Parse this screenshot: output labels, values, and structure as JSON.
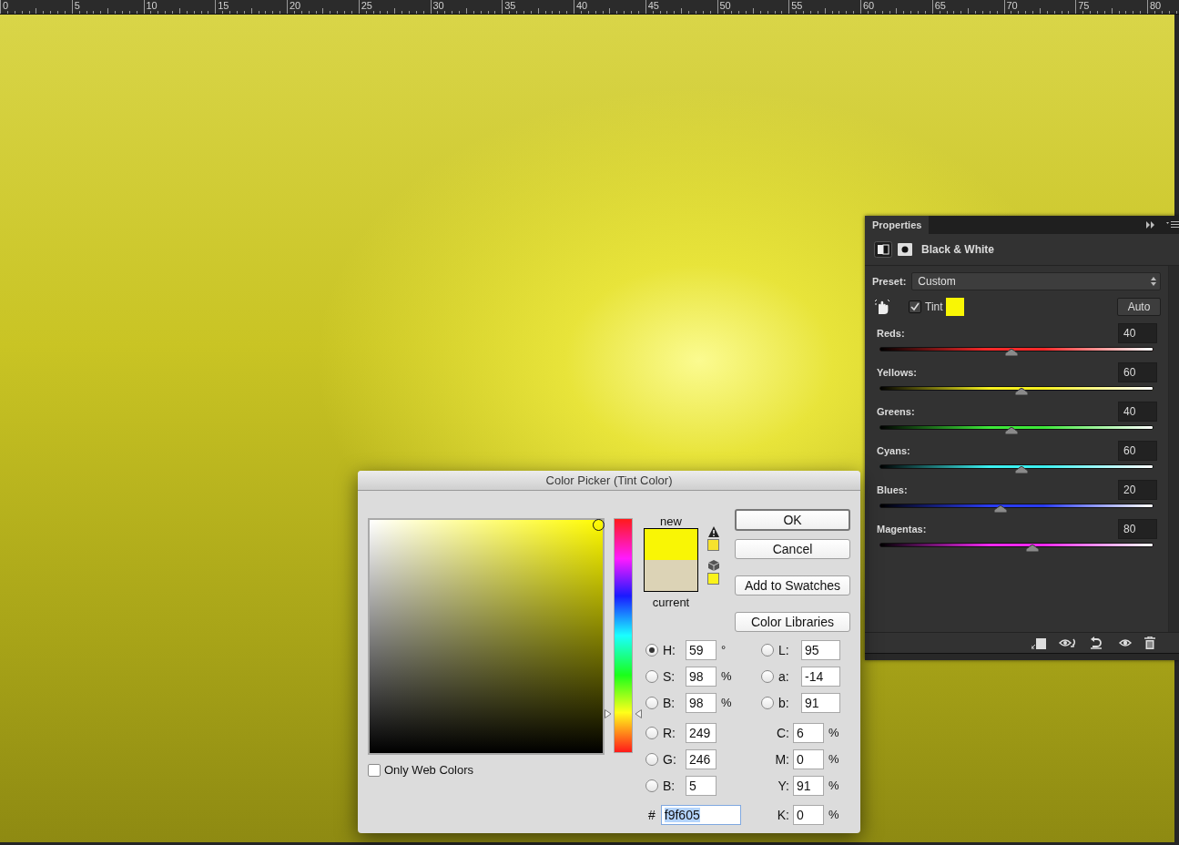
{
  "ruler": {
    "labels": [
      "0",
      "5",
      "10",
      "15",
      "20",
      "25",
      "30",
      "35",
      "40",
      "45",
      "50",
      "55",
      "60",
      "65",
      "70",
      "75",
      "80"
    ]
  },
  "properties_panel": {
    "tab": "Properties",
    "title": "Black & White",
    "preset": {
      "label": "Preset:",
      "value": "Custom"
    },
    "tint": {
      "label": "Tint",
      "checked": true,
      "color": "#f9f605"
    },
    "auto_button": "Auto",
    "sliders": [
      {
        "label": "Reds:",
        "value": "40",
        "level": 0.48,
        "color": "#ff2a2a"
      },
      {
        "label": "Yellows:",
        "value": "60",
        "level": 0.52,
        "color": "#f5f020"
      },
      {
        "label": "Greens:",
        "value": "40",
        "level": 0.48,
        "color": "#3ee83a"
      },
      {
        "label": "Cyans:",
        "value": "60",
        "level": 0.52,
        "color": "#3cf0f0"
      },
      {
        "label": "Blues:",
        "value": "20",
        "level": 0.44,
        "color": "#2a3cf0"
      },
      {
        "label": "Magentas:",
        "value": "80",
        "level": 0.56,
        "color": "#f028f0"
      }
    ]
  },
  "color_picker": {
    "title": "Color Picker (Tint Color)",
    "hue_slider": {
      "level": 0.164
    },
    "swatches": [
      {
        "label": "new",
        "color": "#f9f605"
      },
      {
        "label": "current",
        "color": "#dcd3b6"
      }
    ],
    "gamut_swatches": [
      {
        "kind": "warning",
        "color": "#f6e22e"
      },
      {
        "kind": "web",
        "color": "#faf31a"
      }
    ],
    "buttons": [
      {
        "label": "OK",
        "default": true
      },
      {
        "label": "Cancel",
        "default": false
      },
      {
        "label": "Add to Swatches",
        "default": false
      },
      {
        "label": "Color Libraries",
        "default": false
      }
    ],
    "only_web_colors": {
      "label": "Only Web Colors",
      "checked": false
    },
    "left_fields": [
      {
        "kind": "radio",
        "label": "H:",
        "value": "59",
        "unit": "°",
        "selected": true
      },
      {
        "kind": "radio",
        "label": "S:",
        "value": "98",
        "unit": "%",
        "selected": false
      },
      {
        "kind": "radio",
        "label": "B:",
        "value": "98",
        "unit": "%",
        "selected": false
      },
      {
        "kind": "radio",
        "label": "R:",
        "value": "249",
        "selected": false
      },
      {
        "kind": "radio",
        "label": "G:",
        "value": "246",
        "selected": false
      },
      {
        "kind": "radio",
        "label": "B:",
        "value": "5",
        "selected": false
      }
    ],
    "hex": {
      "label": "#",
      "value": "f9f605",
      "highlighted": true
    },
    "right_fields": [
      {
        "kind": "radio",
        "label": "L:",
        "value": "95",
        "selected": false
      },
      {
        "kind": "radio",
        "label": "a:",
        "value": "-14",
        "selected": false
      },
      {
        "kind": "radio",
        "label": "b:",
        "value": "91",
        "selected": false
      },
      {
        "kind": "plain",
        "label": "C:",
        "value": "6",
        "unit": "%"
      },
      {
        "kind": "plain",
        "label": "M:",
        "value": "0",
        "unit": "%"
      },
      {
        "kind": "plain",
        "label": "Y:",
        "value": "91",
        "unit": "%"
      },
      {
        "kind": "plain",
        "label": "K:",
        "value": "0",
        "unit": "%"
      }
    ]
  }
}
